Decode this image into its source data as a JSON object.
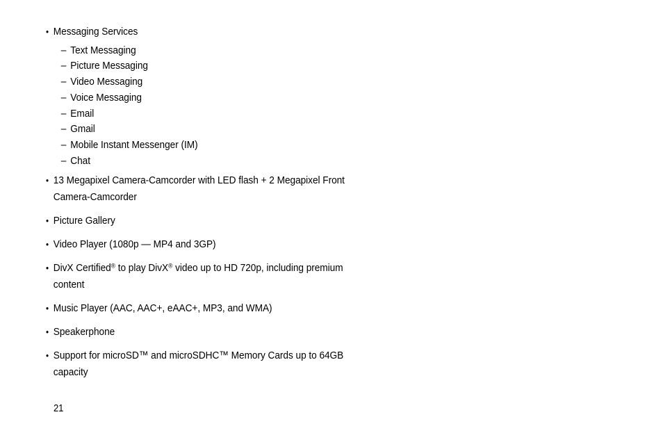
{
  "page": {
    "number": "21",
    "background_color": "#ffffff",
    "text_color": "#000000"
  },
  "content": {
    "bullets": [
      {
        "text": "Messaging Services",
        "sub_items": [
          "Text Messaging",
          "Picture Messaging",
          "Video Messaging",
          "Voice Messaging",
          "Email",
          "Gmail",
          "Mobile Instant Messenger (IM)",
          "Chat"
        ]
      },
      {
        "text": "13 Megapixel Camera-Camcorder with LED flash + 2 Megapixel Front Camera-Camcorder"
      },
      {
        "text": "Picture Gallery"
      },
      {
        "text": "Video Player (1080p — MP4 and 3GP)"
      },
      {
        "text_prefix": "DivX Certified",
        "mark_1": "®",
        "text_middle": " to play DivX",
        "mark_2": "®",
        "text_suffix": " video up to HD 720p, including premium content"
      },
      {
        "text": "Music Player (AAC, AAC+, eAAC+, MP3, and WMA)"
      },
      {
        "text": "Speakerphone"
      },
      {
        "text": "Support for microSD™ and microSDHC™ Memory Cards up to 64GB capacity"
      }
    ]
  }
}
